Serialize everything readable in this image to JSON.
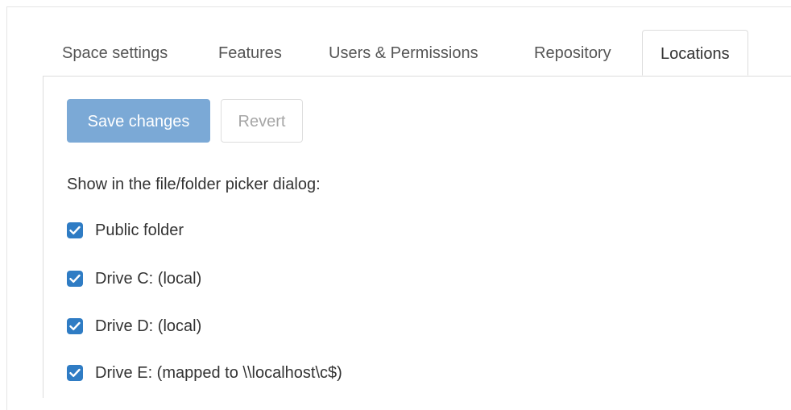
{
  "tabs": [
    {
      "label": "Space settings",
      "active": false
    },
    {
      "label": "Features",
      "active": false
    },
    {
      "label": "Users & Permissions",
      "active": false
    },
    {
      "label": "Repository",
      "active": false
    },
    {
      "label": "Locations",
      "active": true
    }
  ],
  "actions": {
    "save_label": "Save changes",
    "revert_label": "Revert"
  },
  "locations": {
    "caption": "Show in the file/folder picker dialog:",
    "options": [
      {
        "label": "Public folder",
        "checked": true
      },
      {
        "label": "Drive C: (local)",
        "checked": true
      },
      {
        "label": "Drive D: (local)",
        "checked": true
      },
      {
        "label": "Drive E: (mapped to \\\\localhost\\c$)",
        "checked": true
      }
    ]
  },
  "colors": {
    "primary_button": "#7ba9d6",
    "checkbox": "#2f7cc4",
    "border": "#dddddd"
  },
  "icons": [
    "checkmark-icon"
  ]
}
